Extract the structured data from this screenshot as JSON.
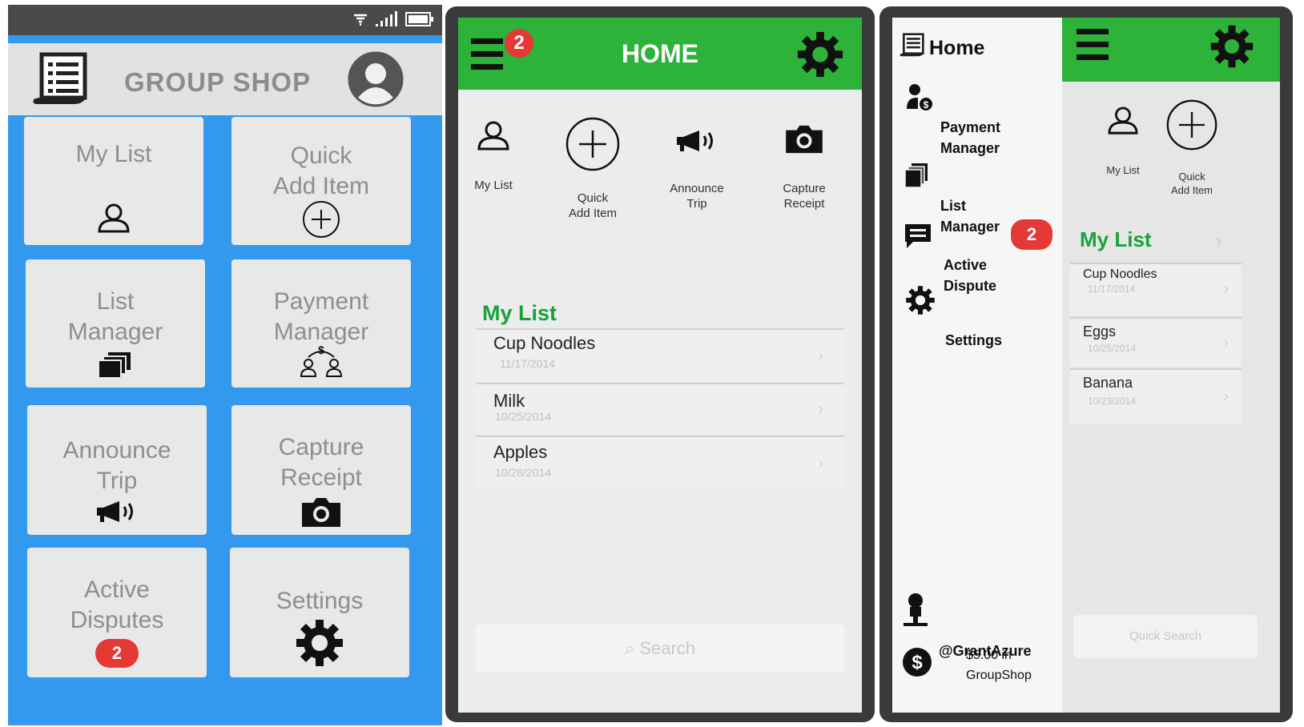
{
  "screen1": {
    "title": "GROUP SHOP",
    "tiles": [
      {
        "label": "My List",
        "icon": "user-icon"
      },
      {
        "label": "Quick\nAdd Item",
        "icon": "plus-circle-icon"
      },
      {
        "label": "List\nManager",
        "icon": "stack-icon"
      },
      {
        "label": "Payment\nManager",
        "icon": "payment-transfer-icon"
      },
      {
        "label": "Announce\nTrip",
        "icon": "megaphone-icon"
      },
      {
        "label": "Capture\nReceipt",
        "icon": "camera-icon"
      },
      {
        "label": "Active\nDisputes",
        "badge": "2"
      },
      {
        "label": "Settings",
        "icon": "gear-icon"
      }
    ]
  },
  "screen2": {
    "title": "HOME",
    "menu_badge": "2",
    "quick_actions": [
      {
        "label": "My List",
        "icon": "user-icon"
      },
      {
        "label": "Quick\nAdd Item",
        "icon": "plus-circle-icon"
      },
      {
        "label": "Announce\nTrip",
        "icon": "megaphone-icon"
      },
      {
        "label": "Capture\nReceipt",
        "icon": "camera-icon"
      }
    ],
    "list_title": "My List",
    "items": [
      {
        "name": "Cup Noodles",
        "date": "11/17/2014"
      },
      {
        "name": "Milk",
        "date": "10/25/2014"
      },
      {
        "name": "Apples",
        "date": "10/28/2014"
      }
    ],
    "search_placeholder": "Search"
  },
  "screen3": {
    "drawer_title": "Home",
    "drawer_items": [
      {
        "label": "Payment\nManager",
        "icon": "payment-user-icon"
      },
      {
        "label": "List\nManager",
        "icon": "stack-icon"
      },
      {
        "label": "Active\nDispute",
        "icon": "chat-icon",
        "badge": "2"
      },
      {
        "label": "Settings",
        "icon": "gear-icon"
      }
    ],
    "username": "@GrantAzure",
    "balance": "$5.00 in\nGroupShop",
    "quick_actions": [
      {
        "label": "My List",
        "icon": "user-icon"
      },
      {
        "label": "Quick\nAdd Item",
        "icon": "plus-circle-icon"
      }
    ],
    "list_title": "My List",
    "items": [
      {
        "name": "Cup Noodles",
        "date": "11/17/2014"
      },
      {
        "name": "Eggs",
        "date": "10/25/2014"
      },
      {
        "name": "Banana",
        "date": "10/23/2014"
      }
    ],
    "search_placeholder": "Quick Search"
  },
  "colors": {
    "green": "#2db23a",
    "blue": "#3399ee",
    "badge": "#e53935"
  }
}
